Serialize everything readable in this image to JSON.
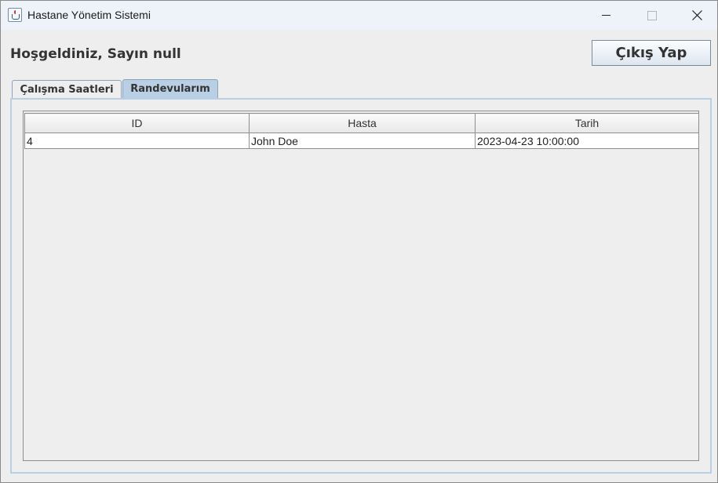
{
  "window": {
    "title": "Hastane Yönetim Sistemi",
    "icon": "java-cup-icon"
  },
  "header": {
    "welcome_text": "Hoşgeldiniz, Sayın null",
    "logout_label": "Çıkış Yap"
  },
  "tabs": [
    {
      "label": "Çalışma Saatleri",
      "selected": false
    },
    {
      "label": "Randevularım",
      "selected": true
    }
  ],
  "appointments": {
    "columns": [
      "ID",
      "Hasta",
      "Tarih"
    ],
    "rows": [
      [
        "4",
        "John Doe",
        "2023-04-23 10:00:00"
      ]
    ]
  },
  "colors": {
    "selected_tab": "#b8cfe5",
    "panel_border": "#b8cfe5",
    "titlebar": "#eef3f9"
  }
}
